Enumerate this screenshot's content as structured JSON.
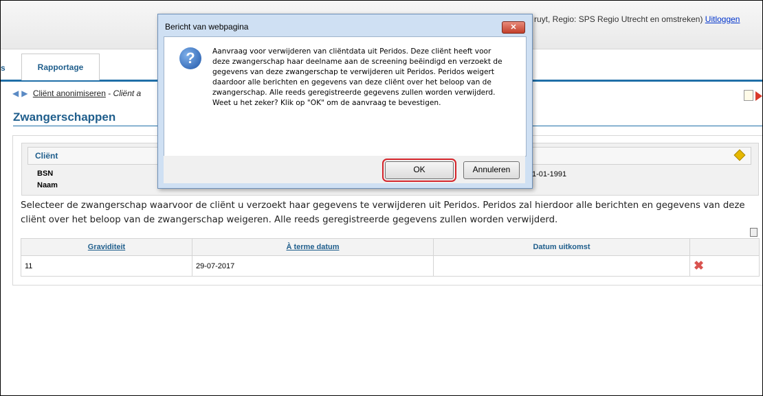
{
  "header": {
    "user_info_text": "ruyt, Regio: SPS Regio Utrecht en omstreken)",
    "logout_label": "Uitloggen"
  },
  "tabs": {
    "partial_tab": "s",
    "active_tab": "Rapportage"
  },
  "breadcrumb": {
    "link": "Cliënt anonimiseren",
    "separator": " - ",
    "sub": "Cliënt a"
  },
  "page_title": "Zwangerschappen",
  "client_panel": {
    "title": "Cliënt",
    "bsn_label": "BSN",
    "naam_label": "Naam",
    "dob_partial": "1-01-1991"
  },
  "instruction_text": "Selecteer de zwangerschap waarvoor de cliënt u verzoekt haar gegevens te verwijderen uit Peridos. Peridos zal hierdoor alle berichten en gegevens van deze cliënt over het beloop van de zwangerschap weigeren. Alle reeds geregistreerde gegevens zullen worden verwijderd.",
  "table": {
    "headers": [
      "Graviditeit",
      "À terme datum",
      "Datum uitkomst",
      ""
    ],
    "rows": [
      {
        "graviditeit": "11",
        "aterme": "29-07-2017",
        "uitkomst": ""
      }
    ]
  },
  "dialog": {
    "title": "Bericht van webpagina",
    "message": "Aanvraag voor verwijderen van cliëntdata uit Peridos. Deze cliënt heeft voor deze zwangerschap haar deelname aan de screening beëindigd en verzoekt de gegevens van deze zwangerschap te verwijderen uit Peridos. Peridos weigert daardoor alle berichten en gegevens van deze cliënt over het beloop van de zwangerschap. Alle reeds geregistreerde gegevens zullen worden verwijderd. Weet u het zeker? Klik op \"OK\" om de aanvraag te bevestigen.",
    "ok_label": "OK",
    "cancel_label": "Annuleren",
    "close_glyph": "✕",
    "icon_glyph": "?"
  },
  "colors": {
    "accent": "#1f5e8c",
    "highlight_border": "#d4242a"
  }
}
